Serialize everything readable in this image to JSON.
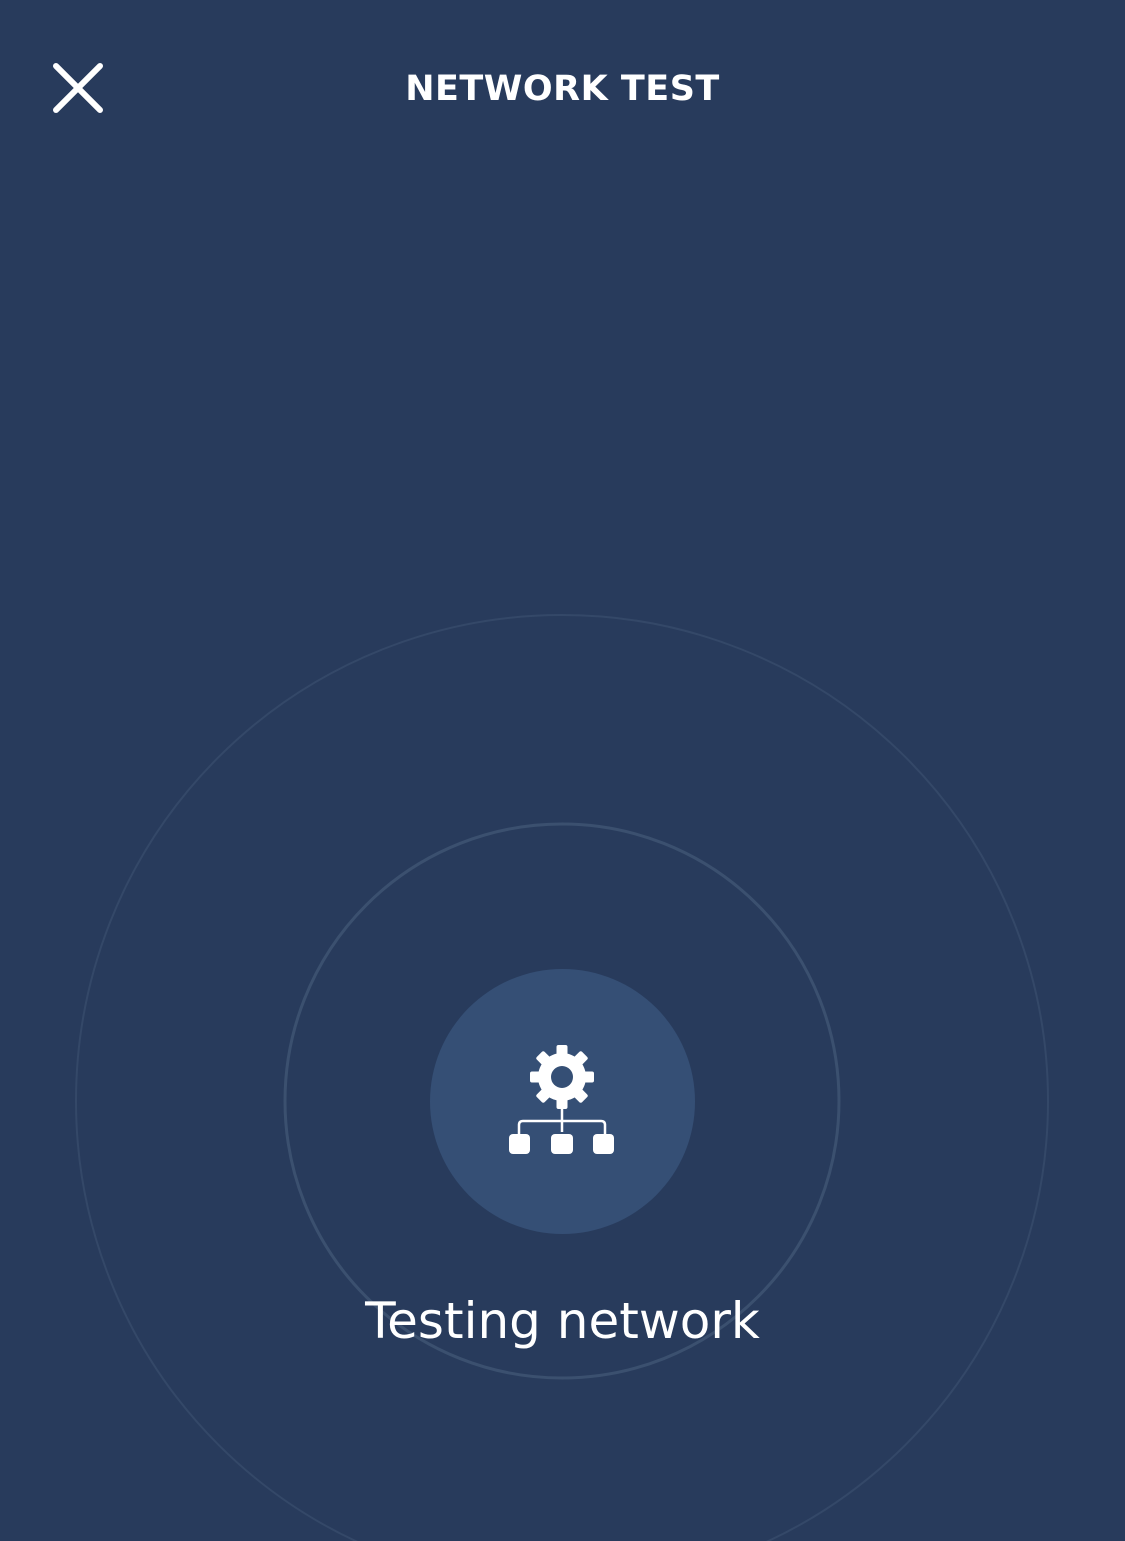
{
  "header": {
    "title": "NETWORK TEST",
    "close_icon": "close-icon"
  },
  "status": {
    "text": "Testing network",
    "icon": "network-settings-icon"
  },
  "colors": {
    "background": "#283b5c",
    "status_circle": "#354f75",
    "foreground": "#ffffff"
  }
}
